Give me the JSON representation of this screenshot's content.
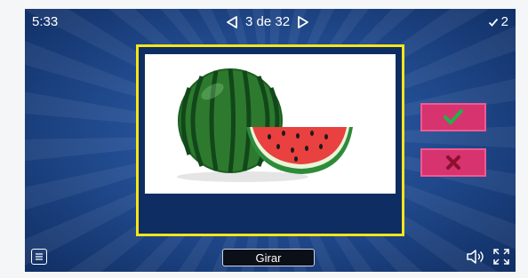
{
  "header": {
    "timer": "5:33",
    "card_position": "3 de 32",
    "score": "2",
    "icons": {
      "prev": "caret-left-icon",
      "next": "caret-right-icon",
      "score": "checkmark-icon"
    }
  },
  "card": {
    "image": "watermelon-illustration"
  },
  "answers": {
    "correct_icon": "checkmark-icon",
    "wrong_icon": "cross-icon"
  },
  "footer": {
    "flip_label": "Girar",
    "icons": {
      "menu": "menu-icon",
      "sound": "speaker-icon",
      "fullscreen": "fullscreen-icon"
    }
  },
  "colors": {
    "frame": "#f5e51b",
    "answer_button": "#d6336f",
    "correct_mark": "#22b24c",
    "wrong_mark": "#8c1030"
  }
}
